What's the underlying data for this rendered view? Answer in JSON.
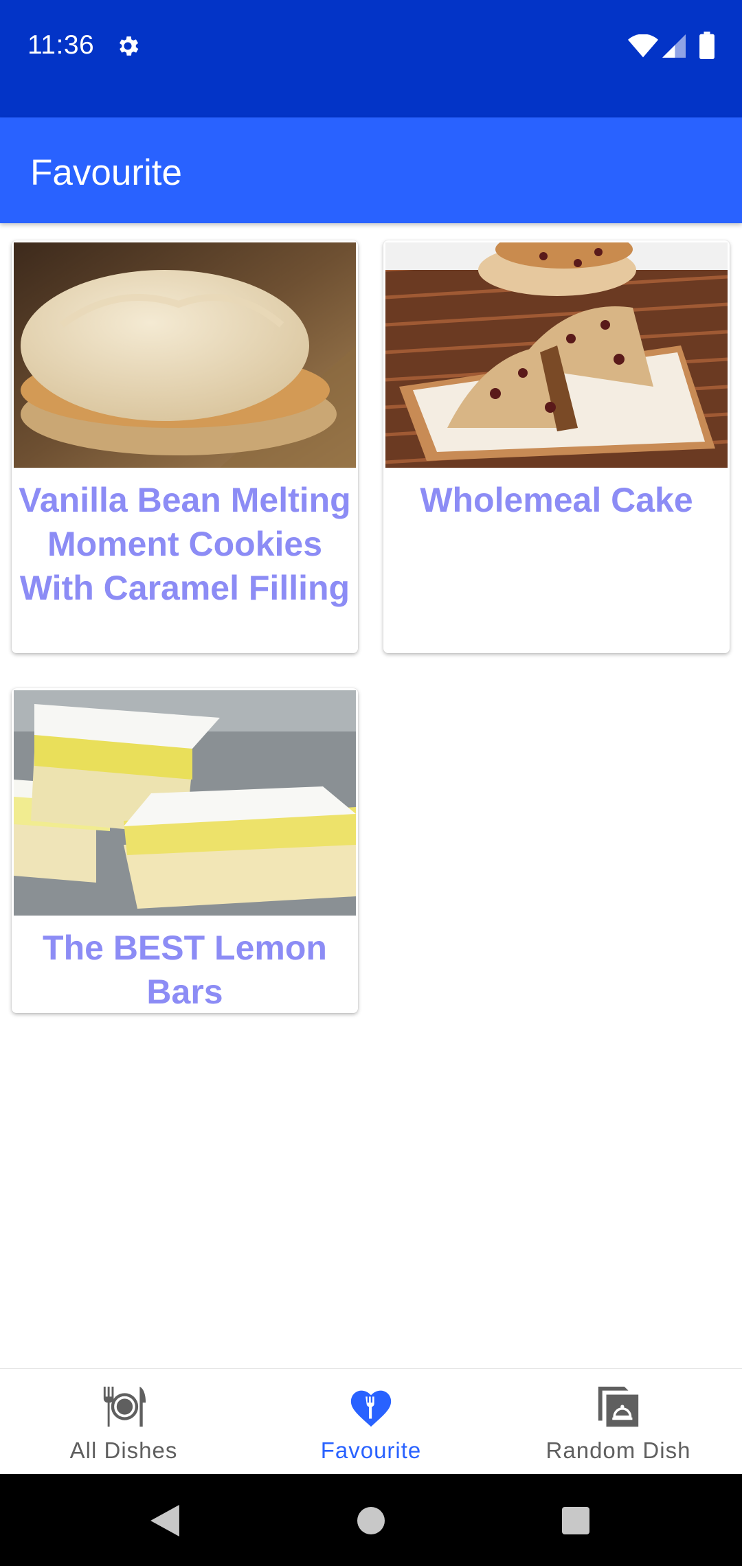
{
  "status_bar": {
    "time": "11:36"
  },
  "app_bar": {
    "title": "Favourite"
  },
  "dishes": [
    {
      "title": "Vanilla Bean Melting Moment Cookies With Caramel Filling"
    },
    {
      "title": "Wholemeal Cake"
    },
    {
      "title": "The BEST Lemon Bars"
    }
  ],
  "bottom_nav": {
    "items": [
      {
        "label": "All Dishes",
        "icon": "plate-cutlery-icon",
        "active": false
      },
      {
        "label": "Favourite",
        "icon": "heart-fork-icon",
        "active": true
      },
      {
        "label": "Random Dish",
        "icon": "random-dish-icon",
        "active": false
      }
    ]
  },
  "colors": {
    "status_bar": "#0334c7",
    "app_bar": "#2962ff",
    "title_text": "#8c8cf5",
    "nav_active": "#2962ff",
    "nav_inactive": "#5f5f5f"
  }
}
